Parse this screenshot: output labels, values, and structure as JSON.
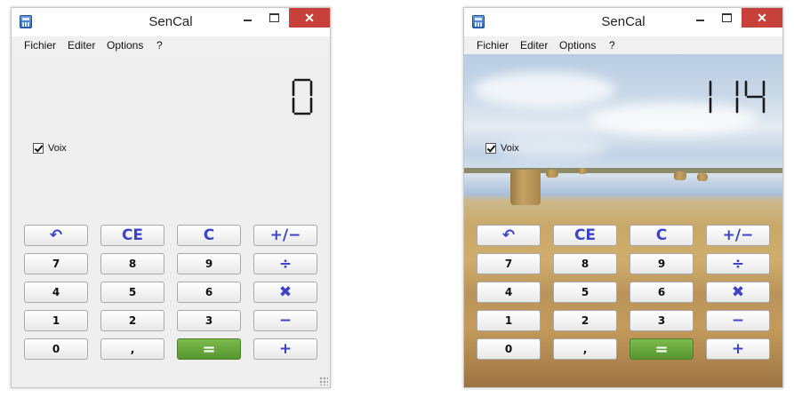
{
  "windows": [
    {
      "title": "SenCal",
      "display_value": "0",
      "voix_label": "Voix",
      "voix_checked": true,
      "background": "plain"
    },
    {
      "title": "SenCal",
      "display_value": "114",
      "voix_label": "Voix",
      "voix_checked": true,
      "background": "wheat-field-photo"
    }
  ],
  "menu": [
    "Fichier",
    "Editer",
    "Options",
    "?"
  ],
  "window_controls": {
    "minimize": "minimize-icon",
    "maximize": "maximize-icon",
    "close": "✕"
  },
  "keypad": [
    [
      {
        "label": "↶",
        "name": "backspace",
        "icon": "undo-arrow-icon"
      },
      {
        "label": "CE",
        "name": "ce"
      },
      {
        "label": "C",
        "name": "clear"
      },
      {
        "label": "+∕−",
        "name": "plus-minus"
      }
    ],
    [
      {
        "label": "7",
        "name": "digit-7"
      },
      {
        "label": "8",
        "name": "digit-8"
      },
      {
        "label": "9",
        "name": "digit-9"
      },
      {
        "label": "÷",
        "name": "divide"
      }
    ],
    [
      {
        "label": "4",
        "name": "digit-4"
      },
      {
        "label": "5",
        "name": "digit-5"
      },
      {
        "label": "6",
        "name": "digit-6"
      },
      {
        "label": "✖",
        "name": "multiply"
      }
    ],
    [
      {
        "label": "1",
        "name": "digit-1"
      },
      {
        "label": "2",
        "name": "digit-2"
      },
      {
        "label": "3",
        "name": "digit-3"
      },
      {
        "label": "−",
        "name": "minus"
      }
    ],
    [
      {
        "label": "0",
        "name": "digit-0"
      },
      {
        "label": ",",
        "name": "decimal"
      },
      {
        "label": "=",
        "name": "equals"
      },
      {
        "label": "+",
        "name": "plus"
      }
    ]
  ],
  "colors": {
    "operator": "#3b44c8",
    "equals": "#5fa335",
    "close": "#c7413a"
  }
}
